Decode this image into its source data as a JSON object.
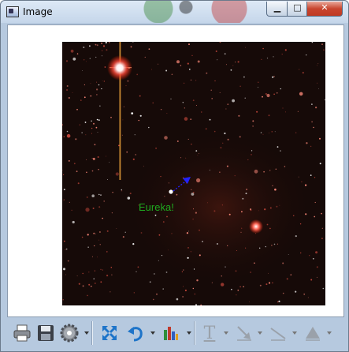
{
  "window": {
    "title": "Image",
    "minimize_glyph": "▁",
    "maximize_glyph": "□",
    "close_glyph": "✕"
  },
  "image": {
    "annotation_text": "Eureka!",
    "annotation_color": "#1fa81f",
    "arrow_color": "#2222ff",
    "description_icons": [
      "bright-star",
      "diffraction-spike"
    ]
  },
  "toolbar": {
    "items": [
      {
        "name": "print-icon",
        "dropdown": false
      },
      {
        "name": "save-icon",
        "dropdown": false
      },
      {
        "name": "settings-icon",
        "dropdown": true
      },
      {
        "name": "fit-to-window-icon",
        "dropdown": false
      },
      {
        "name": "undo-icon",
        "dropdown": true
      },
      {
        "name": "histogram-icon",
        "dropdown": true
      },
      {
        "name": "text-tool-icon",
        "dropdown": true,
        "disabled": true
      },
      {
        "name": "arrow-tool-icon",
        "dropdown": true,
        "disabled": true
      },
      {
        "name": "line-tool-icon",
        "dropdown": true,
        "disabled": true
      },
      {
        "name": "shape-tool-icon",
        "dropdown": true,
        "disabled": true
      }
    ],
    "text_tool_glyph": "T"
  }
}
